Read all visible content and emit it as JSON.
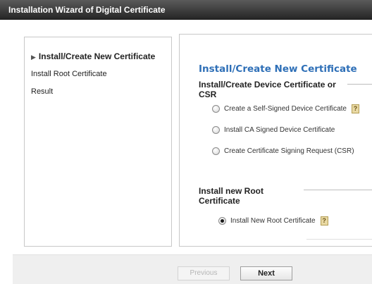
{
  "window": {
    "title": "Installation Wizard of Digital Certificate"
  },
  "sidebar": {
    "items": [
      {
        "label": "Install/Create New Certificate",
        "active": true
      },
      {
        "label": "Install Root Certificate",
        "active": false
      },
      {
        "label": "Result",
        "active": false
      }
    ]
  },
  "main": {
    "title": "Install/Create New Certificate",
    "device_section": {
      "heading_line1": "Install/Create Device Certificate or",
      "heading_line2": "CSR",
      "options": [
        {
          "label": "Create a Self-Signed Device Certificate",
          "checked": false,
          "help": true
        },
        {
          "label": "Install CA Signed Device Certificate",
          "checked": false,
          "help": false
        },
        {
          "label": "Create Certificate Signing Request (CSR)",
          "checked": false,
          "help": false
        }
      ]
    },
    "root_section": {
      "heading_line1": "Install new Root",
      "heading_line2": "Certificate",
      "options": [
        {
          "label": "Install New Root Certificate",
          "checked": true,
          "help": true
        }
      ]
    },
    "help_glyph": "?"
  },
  "footer": {
    "previous_label": "Previous",
    "previous_enabled": false,
    "next_label": "Next"
  },
  "colors": {
    "title_blue": "#2e6fb7",
    "titlebar": "#262626"
  }
}
